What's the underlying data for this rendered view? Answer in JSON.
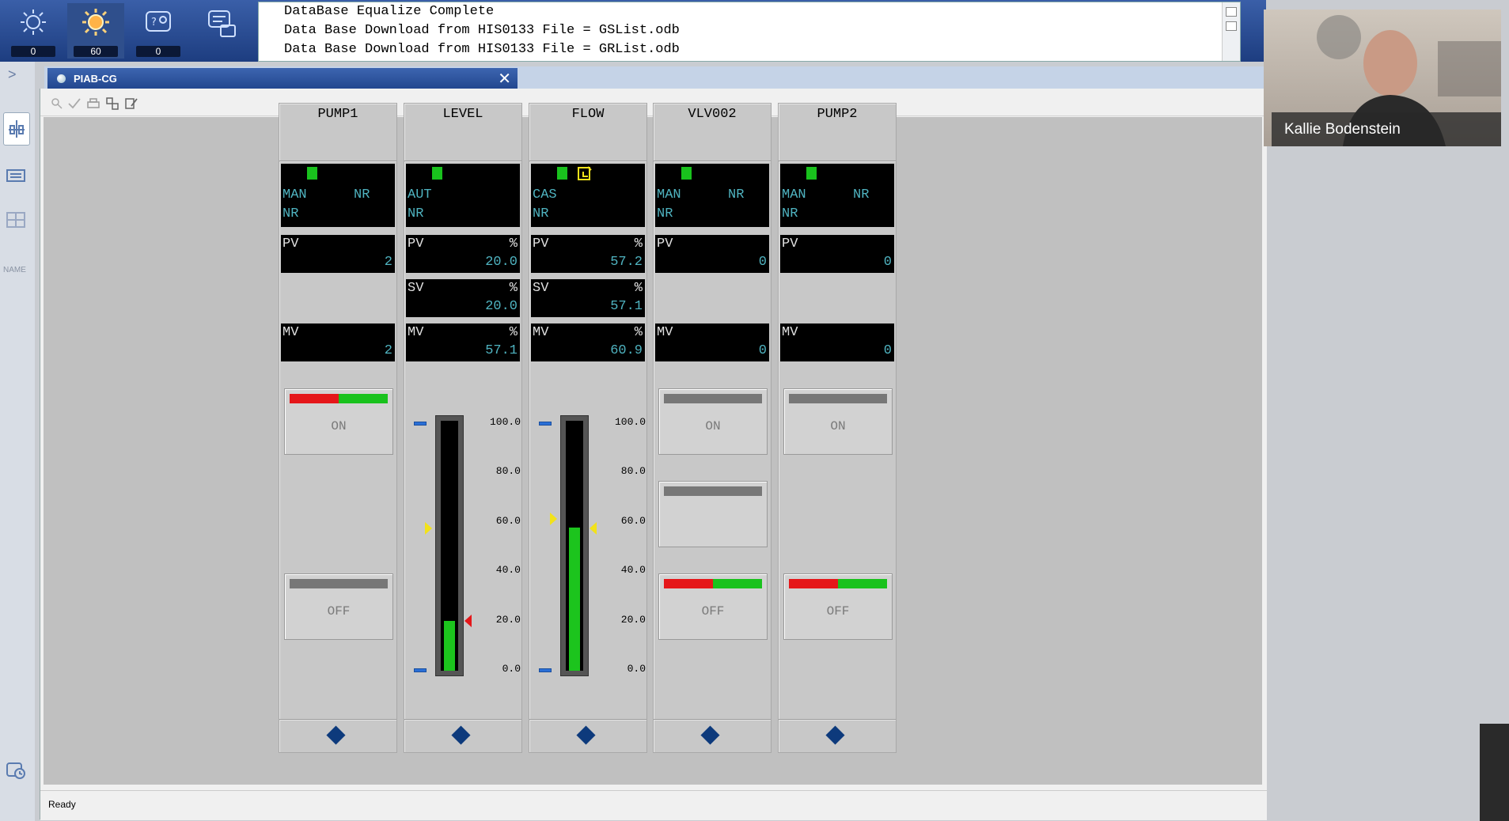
{
  "alarm_buttons": [
    {
      "icon": "process-alarm-icon",
      "count": "0"
    },
    {
      "icon": "system-alarm-icon",
      "count": "60"
    },
    {
      "icon": "operator-guide-icon",
      "count": "0"
    },
    {
      "icon": "message-monitor-icon",
      "count": ""
    }
  ],
  "messages": [
    "DataBase Equalize Complete",
    "Data Base Download from HIS0133 File = GSList.odb",
    "Data Base Download from HIS0133 File = GRList.odb"
  ],
  "window": {
    "tab_title": "PIAB-CG",
    "close_label": "✕",
    "status": "Ready"
  },
  "left_strip": {
    "expand_label": ">",
    "name_label": "NAME"
  },
  "webcam": {
    "participant_name": "Kallie Bodenstein"
  },
  "faceplates": [
    {
      "tag": "PUMP1",
      "mode": "MAN",
      "alarm": "NR",
      "sub": "NR",
      "pv_label": "PV",
      "pv": "2",
      "mv_label": "MV",
      "mv": "2",
      "on_label": "ON",
      "off_label": "OFF",
      "on_active": true,
      "off_active": false
    },
    {
      "tag": "LEVEL",
      "mode": "AUT",
      "alarm": "",
      "sub": "NR",
      "pv_label": "PV",
      "pv": "20.0",
      "pv_unit": "%",
      "sv_label": "SV",
      "sv": "20.0",
      "sv_unit": "%",
      "mv_label": "MV",
      "mv": "57.1",
      "mv_unit": "%",
      "scale": [
        "100.0",
        "80.0",
        "60.0",
        "40.0",
        "20.0",
        "0.0"
      ],
      "pv_fraction": 0.2,
      "sv_fraction": 0.2,
      "mv_fraction": 0.571
    },
    {
      "tag": "FLOW",
      "mode": "CAS",
      "alarm": "",
      "sub": "NR",
      "pv_label": "PV",
      "pv": "57.2",
      "pv_unit": "%",
      "sv_label": "SV",
      "sv": "57.1",
      "sv_unit": "%",
      "mv_label": "MV",
      "mv": "60.9",
      "mv_unit": "%",
      "scale": [
        "100.0",
        "80.0",
        "60.0",
        "40.0",
        "20.0",
        "0.0"
      ],
      "pv_fraction": 0.572,
      "sv_fraction": 0.571,
      "mv_fraction": 0.609
    },
    {
      "tag": "VLV002",
      "mode": "MAN",
      "alarm": "NR",
      "sub": "NR",
      "pv_label": "PV",
      "pv": "0",
      "mv_label": "MV",
      "mv": "0",
      "on_label": "ON",
      "off_label": "OFF",
      "on_active": false,
      "off_active": true
    },
    {
      "tag": "PUMP2",
      "mode": "MAN",
      "alarm": "NR",
      "sub": "NR",
      "pv_label": "PV",
      "pv": "0",
      "mv_label": "MV",
      "mv": "0",
      "on_label": "ON",
      "off_label": "OFF",
      "on_active": false,
      "off_active": true
    }
  ],
  "colors": {
    "led_green": "#19c21d",
    "alarm_red": "#e5171a",
    "value_cyan": "#4fb3c0",
    "pointer_yellow": "#f2e21a"
  }
}
